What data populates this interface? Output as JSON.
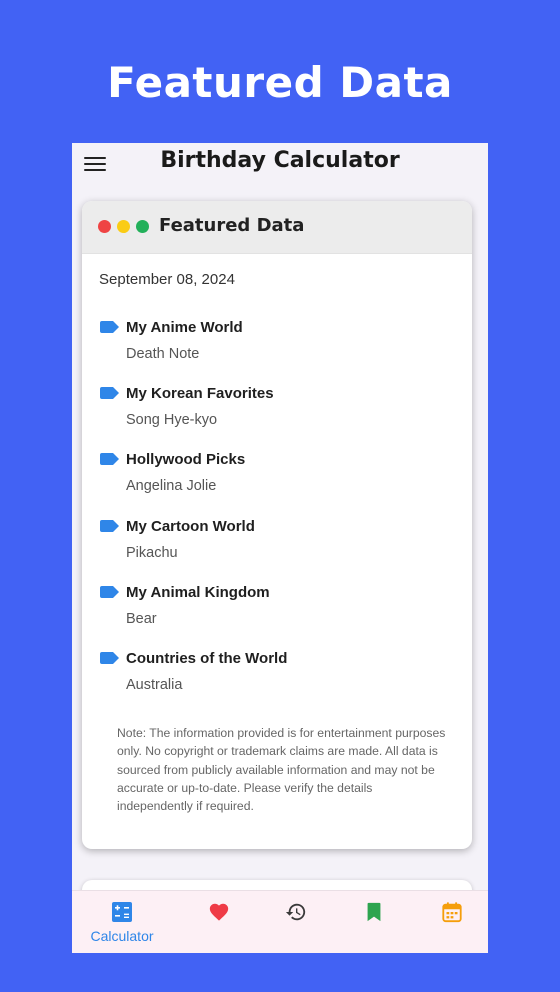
{
  "headline": "Featured Data",
  "app_bar": {
    "title": "Birthday Calculator"
  },
  "card": {
    "title": "Featured Data",
    "date": "September 08, 2024",
    "items": [
      {
        "title": "My Anime World",
        "value": "Death Note"
      },
      {
        "title": "My Korean Favorites",
        "value": "Song Hye-kyo"
      },
      {
        "title": "Hollywood Picks",
        "value": "Angelina Jolie"
      },
      {
        "title": "My Cartoon World",
        "value": "Pikachu"
      },
      {
        "title": "My Animal Kingdom",
        "value": "Bear"
      },
      {
        "title": "Countries of the World",
        "value": "Australia"
      }
    ],
    "note": "Note: The information provided is for entertainment purposes only. No copyright or trademark claims are made. All data is sourced from publicly available information and may not be accurate or up-to-date. Please verify the details independently if required."
  },
  "bottom_nav": {
    "items": [
      {
        "label": "Calculator",
        "icon": "calculator-icon",
        "active": true
      },
      {
        "icon": "heart-icon"
      },
      {
        "icon": "history-icon"
      },
      {
        "icon": "bookmark-icon"
      },
      {
        "icon": "calendar-icon"
      }
    ]
  },
  "colors": {
    "background": "#4262f4",
    "tag": "#2f86e8",
    "active_nav": "#2f86e8",
    "heart": "#ef3b46",
    "bookmark": "#2ea44f",
    "calendar": "#f59e0b"
  }
}
